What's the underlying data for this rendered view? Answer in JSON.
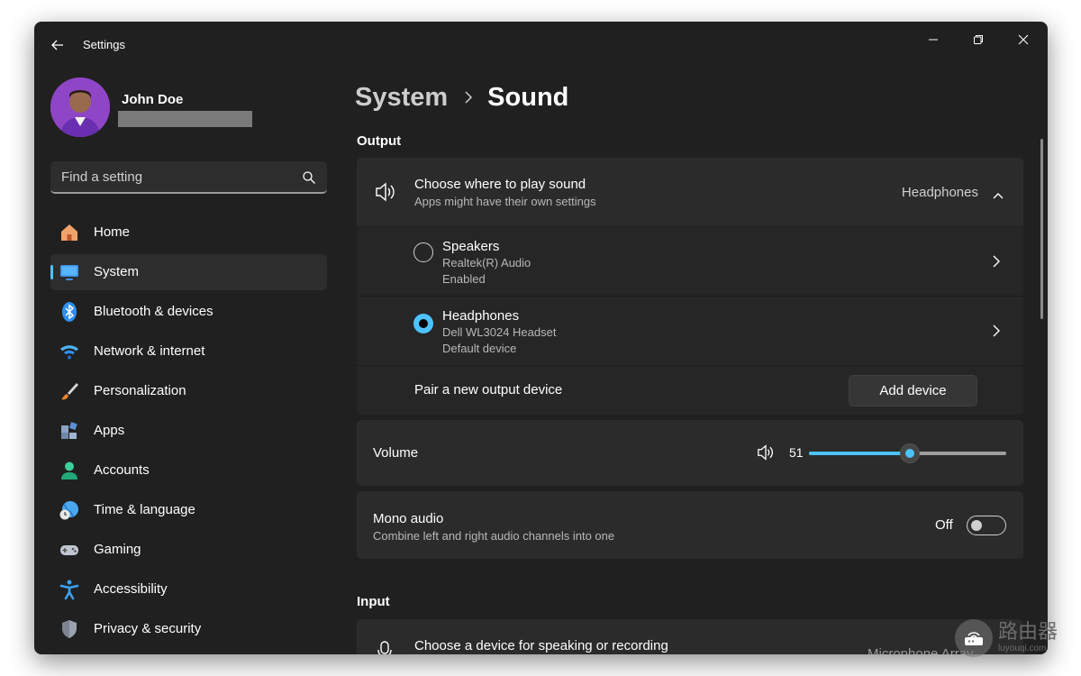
{
  "window": {
    "title": "Settings"
  },
  "profile": {
    "name": "John Doe"
  },
  "search": {
    "placeholder": "Find a setting"
  },
  "nav": {
    "items": [
      {
        "label": "Home",
        "icon": "home-icon"
      },
      {
        "label": "System",
        "icon": "system-icon",
        "active": true
      },
      {
        "label": "Bluetooth & devices",
        "icon": "bluetooth-icon"
      },
      {
        "label": "Network & internet",
        "icon": "wifi-icon"
      },
      {
        "label": "Personalization",
        "icon": "brush-icon"
      },
      {
        "label": "Apps",
        "icon": "apps-icon"
      },
      {
        "label": "Accounts",
        "icon": "accounts-icon"
      },
      {
        "label": "Time & language",
        "icon": "time-language-icon"
      },
      {
        "label": "Gaming",
        "icon": "gamepad-icon"
      },
      {
        "label": "Accessibility",
        "icon": "accessibility-icon"
      },
      {
        "label": "Privacy & security",
        "icon": "shield-icon"
      }
    ]
  },
  "breadcrumb": {
    "parent": "System",
    "current": "Sound"
  },
  "output": {
    "section_title": "Output",
    "choose": {
      "title": "Choose where to play sound",
      "subtitle": "Apps might have their own settings",
      "value": "Headphones"
    },
    "devices": [
      {
        "name": "Speakers",
        "detail": "Realtek(R) Audio",
        "status": "Enabled",
        "selected": false
      },
      {
        "name": "Headphones",
        "detail": "Dell WL3024 Headset",
        "status": "Default device",
        "selected": true
      }
    ],
    "pair": {
      "label": "Pair a new output device",
      "button": "Add device"
    },
    "volume": {
      "label": "Volume",
      "value": "51",
      "level": 0.51
    },
    "mono": {
      "title": "Mono audio",
      "subtitle": "Combine left and right audio channels into one",
      "state": "Off"
    }
  },
  "input": {
    "section_title": "Input",
    "choose": {
      "title": "Choose a device for speaking or recording",
      "value": "Microphone Array"
    }
  },
  "watermark": {
    "text_cn": "路由器",
    "text_en": "luyouqi.com"
  },
  "colors": {
    "accent": "#4cc2ff",
    "window_bg": "#202020",
    "card_bg": "#2b2b2b",
    "sub_bg": "#262626"
  }
}
